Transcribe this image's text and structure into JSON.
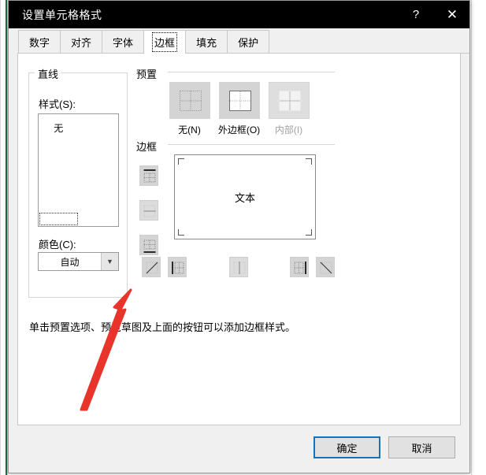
{
  "window": {
    "title": "设置单元格格式",
    "help_icon": "?",
    "close_icon": "✕"
  },
  "tabs": [
    {
      "label": "数字",
      "selected": false
    },
    {
      "label": "对齐",
      "selected": false
    },
    {
      "label": "字体",
      "selected": false
    },
    {
      "label": "边框",
      "selected": true
    },
    {
      "label": "填充",
      "selected": false
    },
    {
      "label": "保护",
      "selected": false
    }
  ],
  "line_group": {
    "legend": "直线",
    "style_label": "样式(S):",
    "none_label": "无",
    "styles": [
      {
        "name": "none",
        "selected": false
      },
      {
        "name": "dash-dot-dot-thin",
        "selected": false
      },
      {
        "name": "dotted-fine",
        "selected": false
      },
      {
        "name": "slant-dash",
        "selected": false
      },
      {
        "name": "dash-dot-fine",
        "selected": false
      },
      {
        "name": "dash-dot-medium",
        "selected": false
      },
      {
        "name": "dashed-medium",
        "selected": false
      },
      {
        "name": "dashed-thick",
        "selected": false
      },
      {
        "name": "dash-dot-long",
        "selected": false
      },
      {
        "name": "solid-medium",
        "selected": false
      },
      {
        "name": "dashed-fine",
        "selected": false
      },
      {
        "name": "solid-thick",
        "selected": false
      },
      {
        "name": "solid-thin",
        "selected": true
      },
      {
        "name": "double",
        "selected": false
      }
    ],
    "color_label": "颜色(C):",
    "color_value": "自动",
    "color_arrow_icon": "▼"
  },
  "preset_group": {
    "legend": "预置",
    "buttons": [
      {
        "label": "无(N)",
        "name": "preset-none",
        "disabled": false
      },
      {
        "label": "外边框(O)",
        "name": "preset-outline",
        "disabled": false
      },
      {
        "label": "内部(I)",
        "name": "preset-inside",
        "disabled": true
      }
    ]
  },
  "border_group": {
    "legend": "边框",
    "preview_text": "文本",
    "side_buttons": [
      {
        "name": "border-top",
        "disabled": false
      },
      {
        "name": "border-horizontal-inside",
        "disabled": true
      },
      {
        "name": "border-bottom",
        "disabled": false
      }
    ],
    "bottom_buttons": [
      {
        "name": "border-diagonal-up",
        "disabled": false
      },
      {
        "name": "border-left",
        "disabled": false
      },
      {
        "name": "border-vertical-inside",
        "disabled": true
      },
      {
        "name": "border-right",
        "disabled": false
      },
      {
        "name": "border-diagonal-down",
        "disabled": false
      }
    ]
  },
  "help_text": "单击预置选项、预览草图及上面的按钮可以添加边框样式。",
  "footer": {
    "ok_label": "确定",
    "cancel_label": "取消"
  },
  "colors": {
    "titlebar_bg": "#000000",
    "dialog_bg": "#f0f0f0",
    "accent_focus": "#1573bd",
    "annotation_arrow": "#e8342a",
    "grid_line": "#d8d8d8"
  },
  "annotation": {
    "arrow_name": "red-pointer-arrow",
    "points_to": "border-diagonal-up"
  }
}
